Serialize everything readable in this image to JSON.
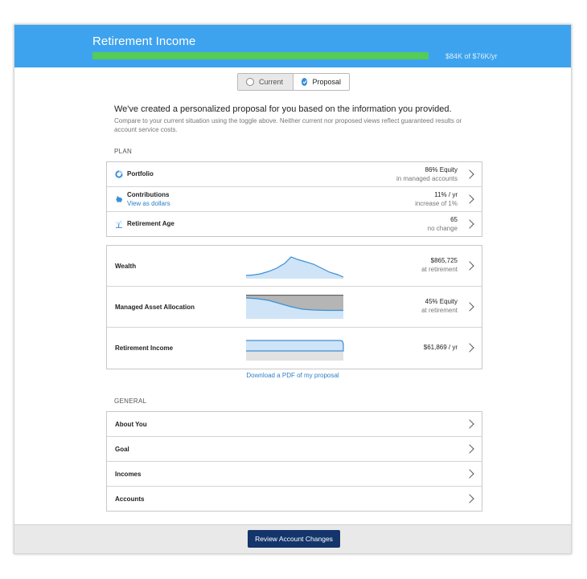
{
  "header": {
    "title": "Retirement Income",
    "progress_fraction": 1.0,
    "progress_text": "$84K of $76K/yr"
  },
  "toggle": {
    "current_label": "Current",
    "proposal_label": "Proposal",
    "selected": "Proposal"
  },
  "intro": {
    "title": "We've created a personalized proposal for you based on the information you provided.",
    "subtitle": "Compare to your current situation using the toggle above. Neither current nor proposed views reflect guaranteed results or account service costs."
  },
  "plan": {
    "label": "PLAN",
    "rows": [
      {
        "title": "Portfolio",
        "icon": "donut-chart-icon",
        "value": "86% Equity",
        "detail": "in managed accounts"
      },
      {
        "title": "Contributions",
        "link": "View as dollars",
        "icon": "piggy-bank-icon",
        "value": "11% / yr",
        "detail": "increase of 1%"
      },
      {
        "title": "Retirement Age",
        "icon": "palm-tree-icon",
        "value": "65",
        "detail": "no change"
      }
    ]
  },
  "charts": {
    "rows": [
      {
        "title": "Wealth",
        "value": "$865,725",
        "detail": "at retirement"
      },
      {
        "title": "Managed Asset Allocation",
        "value": "45% Equity",
        "detail": "at retirement"
      },
      {
        "title": "Retirement Income",
        "value": "$61,869 / yr",
        "detail": ""
      }
    ],
    "colors": {
      "line": "#3b8fd8",
      "fill": "#cfe4f6",
      "gray": "#b5b5b5"
    }
  },
  "pdf_link": "Download a PDF of my proposal",
  "general": {
    "label": "GENERAL",
    "rows": [
      {
        "title": "About You"
      },
      {
        "title": "Goal"
      },
      {
        "title": "Incomes"
      },
      {
        "title": "Accounts"
      }
    ]
  },
  "footer": {
    "review_label": "Review Account Changes"
  }
}
